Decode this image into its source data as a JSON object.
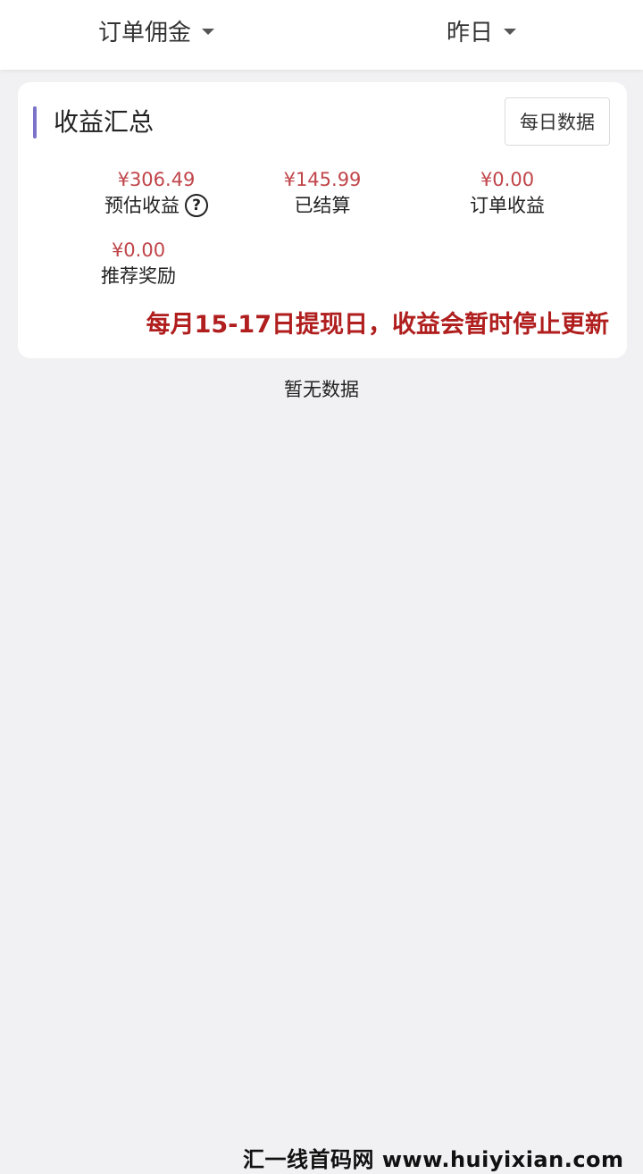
{
  "header": {
    "left_dropdown": "订单佣金",
    "right_dropdown": "昨日"
  },
  "summary": {
    "title": "收益汇总",
    "daily_button": "每日数据",
    "stats": [
      {
        "amount": "¥306.49",
        "label": "预估收益"
      },
      {
        "amount": "¥145.99",
        "label": "已结算"
      },
      {
        "amount": "¥0.00",
        "label": "订单收益"
      },
      {
        "amount": "¥0.00",
        "label": "推荐奖励"
      }
    ],
    "help_glyph": "?",
    "notice": "每月15-17日提现日，收益会暂时停止更新"
  },
  "empty_text": "暂无数据",
  "watermark": "汇一线首码网 www.huiyixian.com",
  "colors": {
    "accent_bar": "#7b74c8",
    "amount": "#c0454a",
    "notice": "#b01e1e",
    "background": "#f1f1f3"
  }
}
